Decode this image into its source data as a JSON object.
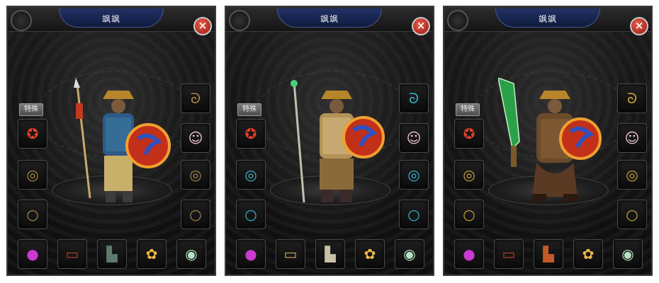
{
  "panels": [
    {
      "title": "飒飒",
      "tag": "特殊",
      "close_label": "×",
      "weapon": "spear",
      "slots": {
        "right": [
          "necklace-icon",
          "jade-pendant-face-icon",
          "bracelet-icon",
          "ring-icon"
        ],
        "left": [
          "special-amulet-icon",
          "bracelet-icon",
          "ring-icon"
        ],
        "bottom": [
          "purple-orb-icon",
          "belt-icon",
          "boots-icon",
          "golden-lotus-icon",
          "jade-disc-icon"
        ]
      }
    },
    {
      "title": "飒飒",
      "tag": "特殊",
      "close_label": "×",
      "weapon": "staff",
      "slots": {
        "right": [
          "necklace-icon",
          "jade-pendant-face-icon",
          "bracelet-icon",
          "ring-icon"
        ],
        "left": [
          "special-amulet-icon",
          "bracelet-icon",
          "ring-icon"
        ],
        "bottom": [
          "purple-orb-icon",
          "belt-icon",
          "boots-icon",
          "golden-lotus-icon",
          "jade-disc-icon"
        ]
      }
    },
    {
      "title": "飒飒",
      "tag": "特殊",
      "close_label": "×",
      "weapon": "green-sword",
      "slots": {
        "right": [
          "necklace-icon",
          "jade-pendant-face-icon",
          "bracelet-icon",
          "ring-icon"
        ],
        "left": [
          "special-amulet-icon",
          "bracelet-icon",
          "ring-icon"
        ],
        "bottom": [
          "purple-orb-icon",
          "belt-icon",
          "boots-icon",
          "golden-lotus-icon",
          "jade-disc-icon"
        ]
      }
    }
  ]
}
